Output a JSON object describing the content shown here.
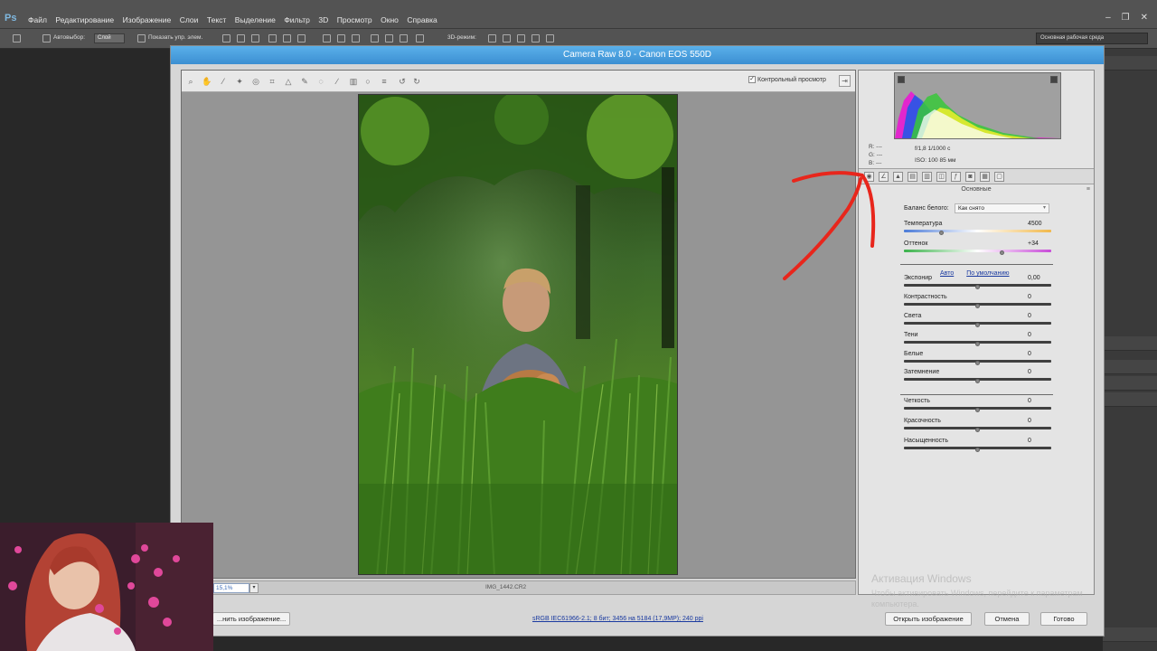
{
  "photoshop": {
    "logo": "Ps",
    "menu": [
      "Файл",
      "Редактирование",
      "Изображение",
      "Слои",
      "Текст",
      "Выделение",
      "Фильтр",
      "3D",
      "Просмотр",
      "Окно",
      "Справка"
    ],
    "options_bar": {
      "autoselect": "Автовыбор:",
      "layer": "Слой",
      "show_controls": "Показать упр. элем.",
      "mode3d": "3D-режим:"
    },
    "workspace": "Основная рабочая среда",
    "window_controls": [
      "–",
      "❐",
      "✕"
    ]
  },
  "camera_raw": {
    "title": "Camera Raw 8.0  -  Canon EOS 550D",
    "preview_label": "Контрольный просмотр",
    "preview_checked": "✓",
    "zoom_value": "15,1%",
    "filename": "IMG_1442.CR2",
    "workflow_info": "sRGB IEC61966-2.1; 8 бит; 3456 на 5184 (17,9МР); 240 ppi",
    "buttons": {
      "save_image": "...нить изображение...",
      "open_image": "Открыть изображение",
      "cancel": "Отмена",
      "done": "Готово"
    },
    "readout": {
      "r": "R:   ---",
      "g": "G:   ---",
      "b": "B:   ---",
      "aperture_shutter": "f/1,8    1/1000 с",
      "iso_focal": "ISO: 100    85 мм"
    },
    "panel_title": "Основные",
    "white_balance": {
      "label": "Баланс белого:",
      "value": "Как снято"
    },
    "links": {
      "auto": "Авто",
      "default": "По умолчанию"
    },
    "sliders": [
      {
        "label": "Температура",
        "value": "4500",
        "fraction": 0.26
      },
      {
        "label": "Оттенок",
        "value": "+34",
        "fraction": 0.67
      },
      {
        "label": "Экспонир",
        "value": "0,00",
        "fraction": 0.5
      },
      {
        "label": "Контрастность",
        "value": "0",
        "fraction": 0.5
      },
      {
        "label": "Света",
        "value": "0",
        "fraction": 0.5
      },
      {
        "label": "Тени",
        "value": "0",
        "fraction": 0.5
      },
      {
        "label": "Белые",
        "value": "0",
        "fraction": 0.5
      },
      {
        "label": "Затемнение",
        "value": "0",
        "fraction": 0.5
      },
      {
        "label": "Четкость",
        "value": "0",
        "fraction": 0.5
      },
      {
        "label": "Красочность",
        "value": "0",
        "fraction": 0.5
      },
      {
        "label": "Насыщенность",
        "value": "0",
        "fraction": 0.5
      }
    ]
  },
  "watermark": {
    "title": "Активация Windows",
    "subtitle": "Чтобы активировать Windows, перейдите к параметрам компьютера."
  },
  "colors": {
    "title_bar": "#3c8fd2",
    "annotation_arrow": "#e8261c",
    "link": "#1a3aa0"
  }
}
